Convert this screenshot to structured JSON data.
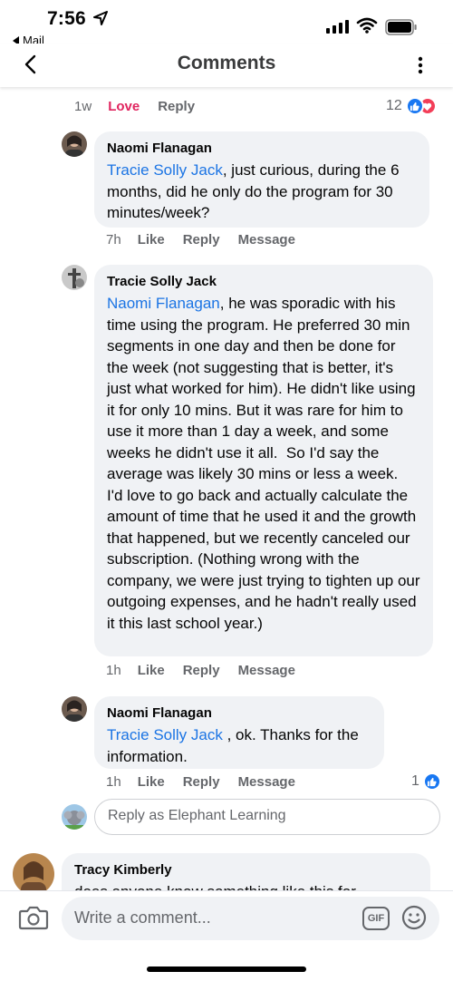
{
  "status_bar": {
    "time": "7:56",
    "back_app": "Mail"
  },
  "header": {
    "title": "Comments"
  },
  "prev_comment_meta": {
    "time": "1w",
    "reaction": "Love",
    "reply": "Reply",
    "reaction_count": "12"
  },
  "comments": [
    {
      "author": "Naomi Flanagan",
      "mention": "Tracie Solly Jack",
      "text": ", just curious, during the 6 months, did he only do the program for 30 minutes/week?",
      "time": "7h",
      "like": "Like",
      "reply": "Reply",
      "message": "Message"
    },
    {
      "author": "Tracie Solly Jack",
      "mention": "Naomi Flanagan",
      "text": ", he was sporadic with his time using the program. He preferred 30 min segments in one day and then be done for the week (not suggesting that is better, it's just what worked for him). He didn't like using it for only 10 mins. But it was rare for him to use it more than 1 day a week, and some weeks he didn't use it all.  So I'd say the average was likely 30 mins or less a week.  I'd love to go back and actually calculate the amount of time that he used it and the growth that happened, but we recently canceled our subscription. (Nothing wrong with the company, we were just trying to tighten up our outgoing expenses, and he hadn't really used it this last school year.)",
      "time": "1h",
      "like": "Like",
      "reply": "Reply",
      "message": "Message"
    },
    {
      "author": "Naomi Flanagan",
      "mention": "Tracie Solly Jack",
      "text": " , ok. Thanks for the information.",
      "time": "1h",
      "like": "Like",
      "reply": "Reply",
      "message": "Message",
      "reaction_count": "1"
    },
    {
      "author": "Tracy Kimberly",
      "text": "does anyone know something like this for"
    }
  ],
  "reply_as": {
    "placeholder": "Reply as Elephant Learning"
  },
  "composer": {
    "placeholder": "Write a comment...",
    "gif_label": "GIF"
  },
  "colors": {
    "mention": "#1b74e4",
    "love": "#e0245e",
    "like_blue": "#1877f2",
    "bubble_bg": "#f0f2f5",
    "meta_gray": "#65676b"
  }
}
